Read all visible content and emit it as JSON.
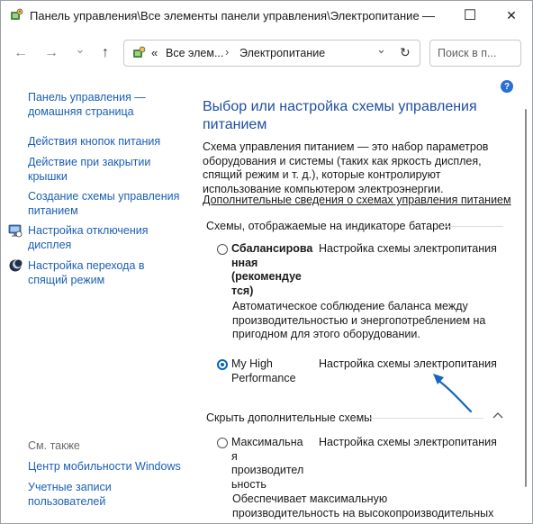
{
  "window": {
    "title": "Панель управления\\Все элементы панели управления\\Электропитание",
    "minimize": "—",
    "maximize": "☐",
    "close": "✕"
  },
  "nav": {
    "back": "←",
    "forward": "→",
    "dropdown": "⌄",
    "up": "↑",
    "address_prefix": "«",
    "address_segment_1": "Все элем...",
    "address_sep": "›",
    "address_segment_2": "Электропитание",
    "address_dropdown": "⌄",
    "refresh": "↻",
    "search_placeholder": "Поиск в п..."
  },
  "help": "?",
  "sidebar": {
    "home_line1": "Панель управления —",
    "home_line2": "домашняя страница",
    "items": [
      {
        "line1": "Действия кнопок питания",
        "line2": ""
      },
      {
        "line1": "Действие при закрытии",
        "line2": "крышки"
      },
      {
        "line1": "Создание схемы управления",
        "line2": "питанием"
      },
      {
        "line1": "Настройка отключения",
        "line2": "дисплея"
      },
      {
        "line1": "Настройка перехода в",
        "line2": "спящий режим"
      }
    ],
    "see_also": "См. также",
    "see_also_items": [
      {
        "line1": "Центр мобильности Windows",
        "line2": ""
      },
      {
        "line1": "Учетные записи",
        "line2": "пользователей"
      }
    ]
  },
  "main": {
    "title_line1": "Выбор или настройка схемы управления",
    "title_line2": "питанием",
    "desc_line1": "Схема управления питанием — это набор параметров",
    "desc_line2": "оборудования и системы (таких как яркость дисплея,",
    "desc_line3": "спящий режим и т. д.), которые контролируют",
    "desc_line4": "использование компьютером электроэнергии.",
    "more_link": "Дополнительные сведения о схемах управления питанием",
    "battery_section": "Схемы, отображаемые на индикаторе батареи",
    "hidden_section": "Скрыть дополнительные схемы",
    "configure_label": "Настройка схемы электропитания",
    "plans": [
      {
        "name_lines": [
          "Сбалансирова",
          "нная",
          "(рекомендуе",
          "тся)"
        ],
        "desc_lines": [
          "Автоматическое соблюдение баланса между",
          "производительностью и энергопотреблением на",
          "пригодном для этого оборудовании."
        ],
        "selected": false
      },
      {
        "name_lines": [
          "My High",
          "Performance"
        ],
        "desc_lines": [],
        "selected": true
      },
      {
        "name_lines": [
          "Максимальна",
          "я",
          "производител",
          "ьность"
        ],
        "desc_lines": [
          "Обеспечивает максимальную",
          "производительность на высокопроизводительных"
        ],
        "selected": false
      }
    ]
  },
  "colors": {
    "link": "#1a5fb4",
    "title": "#1e4e9c",
    "radio_selected": "#0b62c4",
    "arrow": "#1565c0"
  }
}
